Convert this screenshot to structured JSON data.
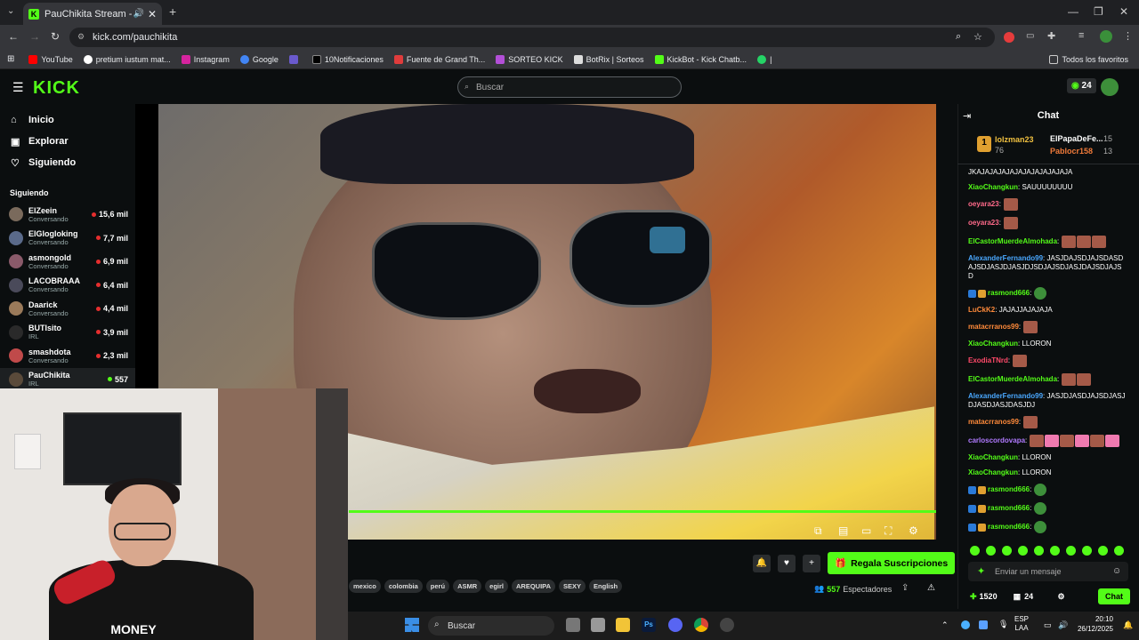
{
  "browser": {
    "tab_title": "PauChikita Stream - Watch",
    "url": "kick.com/pauchikita",
    "bookmarks": [
      "YouTube",
      "pretium iustum mat...",
      "Instagram",
      "Google",
      "",
      "10Notificaciones",
      "Fuente de Grand Th...",
      "SORTEO KICK",
      "BotRix | Sorteos",
      "KickBot - Kick Chatb..."
    ],
    "all_bookmarks": "Todos los favoritos"
  },
  "header": {
    "logo": "KICK",
    "search_placeholder": "Buscar",
    "points": "24"
  },
  "sidebar": {
    "nav": [
      "Inicio",
      "Explorar",
      "Siguiendo"
    ],
    "following_title": "Siguiendo",
    "channels": [
      {
        "name": "ElZeein",
        "sub": "Conversando",
        "viewers": "15,6 mil"
      },
      {
        "name": "ElGlogloking",
        "sub": "Conversando",
        "viewers": "7,7 mil"
      },
      {
        "name": "asmongold",
        "sub": "Conversando",
        "viewers": "6,9 mil"
      },
      {
        "name": "LACOBRAAA",
        "sub": "Conversando",
        "viewers": "6,4 mil"
      },
      {
        "name": "Daarick",
        "sub": "Conversando",
        "viewers": "4,4 mil"
      },
      {
        "name": "BUTIsito",
        "sub": "IRL",
        "viewers": "3,9 mil"
      },
      {
        "name": "smashdota",
        "sub": "Conversando",
        "viewers": "2,3 mil"
      },
      {
        "name": "PauChikita",
        "sub": "IRL",
        "viewers": "557"
      }
    ]
  },
  "stream": {
    "tags": [
      "mexico",
      "colombia",
      "perú",
      "ASMR",
      "egirl",
      "AREQUIPA",
      "SEXY",
      "English"
    ],
    "gift_label": "Regala Suscripciones",
    "viewers": "557",
    "viewers_label": "Espectadores",
    "webcam_shirt": "MONEY"
  },
  "chat": {
    "title": "Chat",
    "leaderboard": [
      {
        "rank": "1",
        "name": "lolzman23",
        "score": "76"
      },
      {
        "name": "ElPapaDeFe...",
        "score": "15"
      },
      {
        "name": "Pablocr158",
        "score": "13"
      }
    ],
    "messages": [
      {
        "user": "",
        "text": "JKAJAJAJAJAJAJAJAJAJAJAJA",
        "color": "#ffffff",
        "emotes": 0
      },
      {
        "user": "XiaoChangkun",
        "text": "SAUUUUUUUU",
        "color": "#53fc18",
        "emotes": 0
      },
      {
        "user": "oeyara23",
        "text": "",
        "color": "#ff6a8a",
        "emotes": 1
      },
      {
        "user": "oeyara23",
        "text": "",
        "color": "#ff6a8a",
        "emotes": 1
      },
      {
        "user": "ElCastorMuerdeAlmohada",
        "text": "",
        "color": "#53fc18",
        "emotes": 3
      },
      {
        "user": "AlexanderFernando99",
        "text": "JASJDAJSDJAJSDASDAJSDJASJDJASJDJSDJAJSDJASJDAJSDJAJSD",
        "color": "#4aa8ff",
        "emotes": 0
      },
      {
        "user": "rasmond666",
        "text": "",
        "color": "#53fc18",
        "emotes": 0,
        "pepe": true
      },
      {
        "user": "LuCkK2",
        "text": "JAJAJJAJAJAJA",
        "color": "#ff8a3a",
        "emotes": 0
      },
      {
        "user": "matacrranos99",
        "text": "",
        "color": "#ff8a3a",
        "emotes": 1
      },
      {
        "user": "XiaoChangkun",
        "text": "LLORON",
        "color": "#53fc18",
        "emotes": 0
      },
      {
        "user": "ExodiaTNrd",
        "text": "",
        "color": "#ff4a6a",
        "emotes": 1
      },
      {
        "user": "ElCastorMuerdeAlmohada",
        "text": "",
        "color": "#53fc18",
        "emotes": 2
      },
      {
        "user": "AlexanderFernando99",
        "text": "JASJDJASDJAJSDJASJDJASDJASJDASJDJ",
        "color": "#4aa8ff",
        "emotes": 0
      },
      {
        "user": "matacrranos99",
        "text": "",
        "color": "#ff8a3a",
        "emotes": 1
      },
      {
        "user": "carloscordovapa",
        "text": "",
        "color": "#b07aff",
        "emotes": 6
      },
      {
        "user": "XiaoChangkun",
        "text": "LLORON",
        "color": "#53fc18",
        "emotes": 0
      },
      {
        "user": "XiaoChangkun",
        "text": "LLORON",
        "color": "#53fc18",
        "emotes": 0
      },
      {
        "user": "rasmond666",
        "text": "",
        "color": "#53fc18",
        "emotes": 0,
        "pepe": true
      },
      {
        "user": "rasmond666",
        "text": "",
        "color": "#53fc18",
        "emotes": 0,
        "pepe": true
      },
      {
        "user": "rasmond666",
        "text": "",
        "color": "#53fc18",
        "emotes": 0,
        "pepe": true
      }
    ],
    "input_placeholder": "Enviar un mensaje",
    "points": "1520",
    "count": "24",
    "send_label": "Chat"
  },
  "taskbar": {
    "search": "Buscar",
    "lang": "ESP",
    "region": "LAA",
    "time": "20:10",
    "date": "26/12/2025"
  },
  "colors": {
    "accent": "#53fc18"
  }
}
